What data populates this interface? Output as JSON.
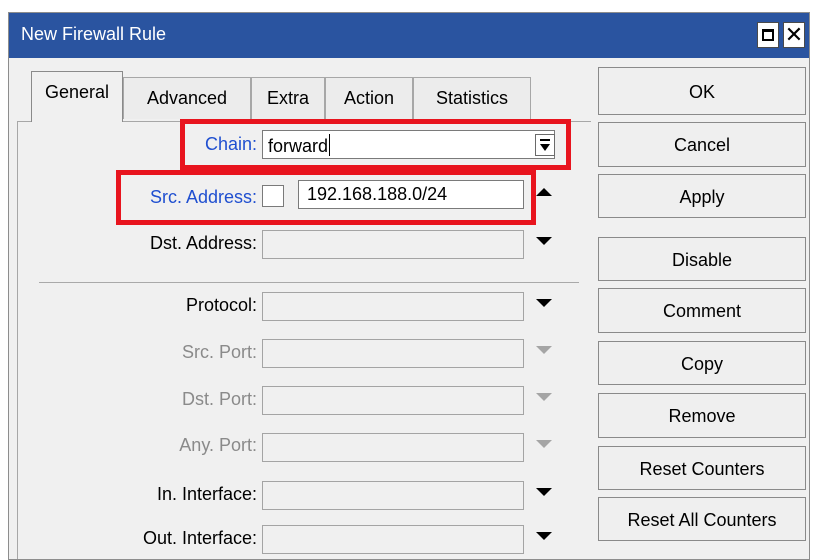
{
  "window": {
    "title": "New Firewall Rule"
  },
  "tabs": [
    {
      "label": "General",
      "active": true
    },
    {
      "label": "Advanced"
    },
    {
      "label": "Extra"
    },
    {
      "label": "Action"
    },
    {
      "label": "Statistics"
    }
  ],
  "form": {
    "chain": {
      "label": "Chain:",
      "value": "forward"
    },
    "src_address": {
      "label": "Src. Address:",
      "value": "192.168.188.0/24",
      "negate_checked": false
    },
    "dst_address": {
      "label": "Dst. Address:",
      "value": ""
    },
    "protocol": {
      "label": "Protocol:",
      "value": ""
    },
    "src_port": {
      "label": "Src. Port:",
      "value": ""
    },
    "dst_port": {
      "label": "Dst. Port:",
      "value": ""
    },
    "any_port": {
      "label": "Any. Port:",
      "value": ""
    },
    "in_interface": {
      "label": "In. Interface:",
      "value": ""
    },
    "out_interface": {
      "label": "Out. Interface:",
      "value": ""
    }
  },
  "buttons": {
    "ok": "OK",
    "cancel": "Cancel",
    "apply": "Apply",
    "disable": "Disable",
    "comment": "Comment",
    "copy": "Copy",
    "remove": "Remove",
    "reset_counters": "Reset Counters",
    "reset_all_counters": "Reset All Counters"
  },
  "colors": {
    "titlebar": "#2a54a0",
    "highlight": "#e8141e",
    "label_active": "#1f4fd0"
  }
}
